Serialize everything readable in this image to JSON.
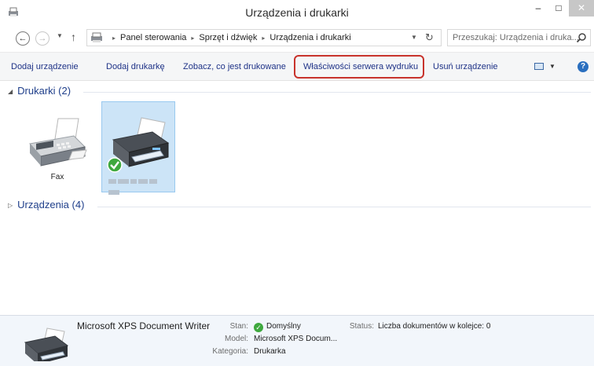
{
  "window": {
    "title": "Urządzenia i drukarki",
    "minimize_glyph": "–",
    "maximize_glyph": "□",
    "close_glyph": "✕"
  },
  "nav": {
    "back_glyph": "←",
    "forward_glyph": "→",
    "recent_glyph": "▼",
    "up_glyph": "↑"
  },
  "address": {
    "breadcrumbs": [
      "Panel sterowania",
      "Sprzęt i dźwięk",
      "Urządzenia i drukarki"
    ],
    "separator": "▸",
    "dropdown_glyph": "▼",
    "refresh_glyph": "↻"
  },
  "search": {
    "placeholder": "Przeszukaj: Urządzenia i druka..."
  },
  "commands": {
    "add_device": "Dodaj urządzenie",
    "add_printer": "Dodaj drukarkę",
    "see_printing": "Zobacz, co jest drukowane",
    "print_server_properties": "Właściwości serwera wydruku",
    "remove_device": "Usuń urządzenie",
    "view_drop_glyph": "▼",
    "help_glyph": "?"
  },
  "groups": {
    "printers": {
      "label": "Drukarki (2)",
      "expanded_glyph": "◢",
      "items": [
        {
          "label": "Fax",
          "icon": "fax-icon"
        },
        {
          "label": "",
          "icon": "printer-icon",
          "default": true
        }
      ]
    },
    "devices": {
      "label": "Urządzenia (4)",
      "collapsed_glyph": "▷"
    }
  },
  "details": {
    "name": "Microsoft XPS Document Writer",
    "state_key": "Stan:",
    "state_value": "Domyślny",
    "state_icon": "✓",
    "model_key": "Model:",
    "model_value": "Microsoft XPS Docum...",
    "category_key": "Kategoria:",
    "category_value": "Drukarka",
    "status_key": "Status:",
    "status_value": "Liczba dokumentów w kolejce: 0"
  },
  "colors": {
    "accent_link": "#1e3287",
    "group_header": "#1e3e8a",
    "highlight_ring": "#c8332c",
    "selection_fill": "#cce4f7",
    "details_bg": "#f2f6fb",
    "default_check": "#3ea83e"
  }
}
